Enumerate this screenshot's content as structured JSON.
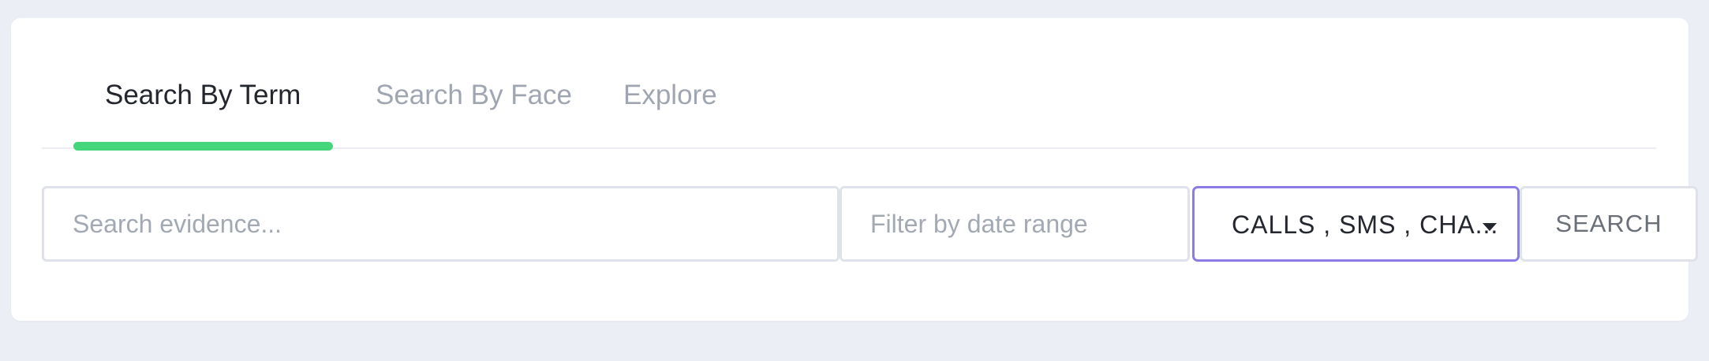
{
  "tabs": [
    {
      "label": "Search By Term",
      "active": true
    },
    {
      "label": "Search By Face",
      "active": false
    },
    {
      "label": "Explore",
      "active": false
    }
  ],
  "search": {
    "placeholder": "Search evidence...",
    "value": ""
  },
  "date_filter": {
    "placeholder": "Filter by date range",
    "value": ""
  },
  "type_filter": {
    "selected": "CALLS , SMS , CHA..."
  },
  "search_button": {
    "label": "SEARCH"
  },
  "colors": {
    "page_background": "#eceef6",
    "active_tab_indicator": "#45d57a",
    "select_focus_border": "#8b7ce9"
  }
}
